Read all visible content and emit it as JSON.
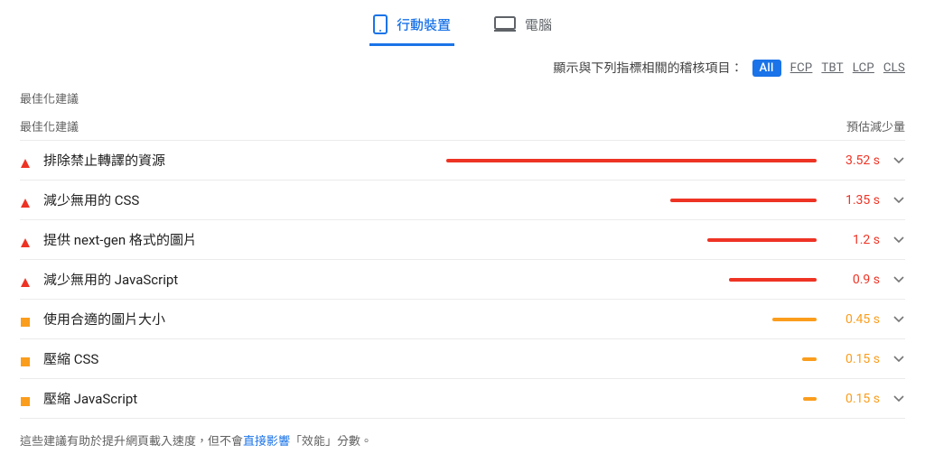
{
  "tabs": {
    "mobile": "行動裝置",
    "desktop": "電腦"
  },
  "filter": {
    "label": "顯示與下列指標相關的稽核項目：",
    "chips": [
      "All",
      "FCP",
      "TBT",
      "LCP",
      "CLS"
    ]
  },
  "section_title": "最佳化建議",
  "columns": {
    "name": "最佳化建議",
    "savings": "預估減少量"
  },
  "audits": [
    {
      "status": "fail",
      "title": "排除禁止轉譯的資源",
      "saving": "3.52 s",
      "bar_pct": 58
    },
    {
      "status": "fail",
      "title": "減少無用的 CSS",
      "saving": "1.35 s",
      "bar_pct": 22
    },
    {
      "status": "fail",
      "title": "提供 next-gen 格式的圖片",
      "saving": "1.2 s",
      "bar_pct": 18
    },
    {
      "status": "fail",
      "title": "減少無用的 JavaScript",
      "saving": "0.9 s",
      "bar_pct": 14
    },
    {
      "status": "avg",
      "title": "使用合適的圖片大小",
      "saving": "0.45 s",
      "bar_pct": 7
    },
    {
      "status": "avg",
      "title": "壓縮 CSS",
      "saving": "0.15 s",
      "bar_pct": 2
    },
    {
      "status": "avg",
      "title": "壓縮 JavaScript",
      "saving": "0.15 s",
      "bar_pct": 2
    }
  ],
  "footer": {
    "before": "這些建議有助於提升網頁載入速度，但不會",
    "link": "直接影響",
    "after": "「效能」分數。"
  }
}
